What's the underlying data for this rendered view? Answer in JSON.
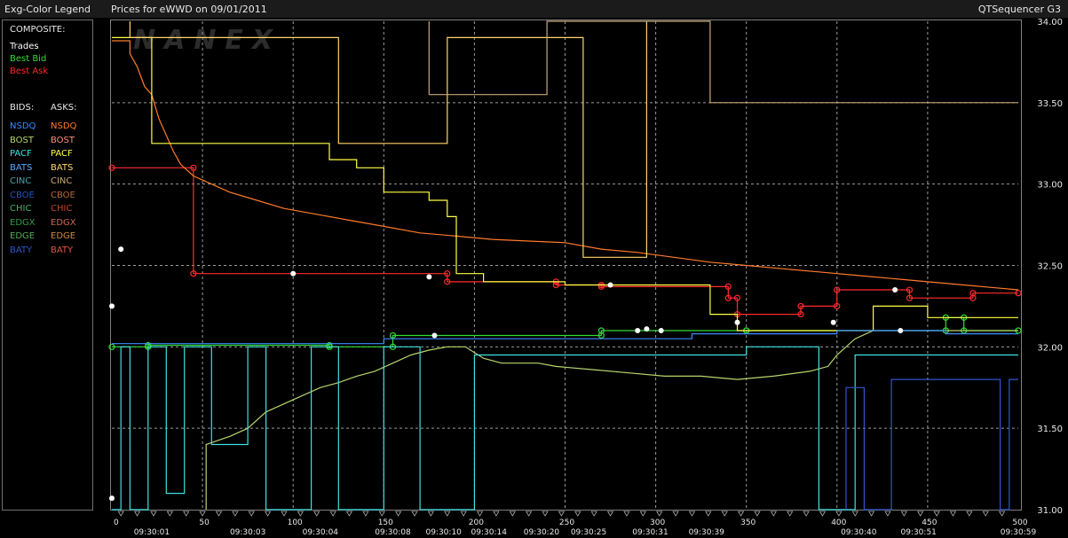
{
  "header": {
    "legend_title": "Exg-Color Legend",
    "chart_title": "Prices for  eWWD  on  09/01/2011",
    "app_name": "QTSequencer G3"
  },
  "legend": {
    "composite_label": "COMPOSITE:",
    "composite": [
      {
        "label": "Trades",
        "color": "#ffffff"
      },
      {
        "label": "Best Bid",
        "color": "#33dd33"
      },
      {
        "label": "Best Ask",
        "color": "#ff2b2b"
      }
    ],
    "bids_label": "BIDS:",
    "asks_label": "ASKS:",
    "rows": [
      {
        "bid": "NSDQ",
        "ask": "NSDQ",
        "bid_color": "#3b8bff",
        "ask_color": "#ff7a2a"
      },
      {
        "bid": "BOST",
        "ask": "BOST",
        "bid_color": "#b5d66b",
        "ask_color": "#ff8f7a"
      },
      {
        "bid": "PACF",
        "ask": "PACF",
        "bid_color": "#3fe0e0",
        "ask_color": "#ffff44"
      },
      {
        "bid": "BATS",
        "ask": "BATS",
        "bid_color": "#5aa8ff",
        "ask_color": "#ffd566"
      },
      {
        "bid": "CINC",
        "ask": "CINC",
        "bid_color": "#4aa8a8",
        "ask_color": "#c8a878"
      },
      {
        "bid": "CBOE",
        "ask": "CBOE",
        "bid_color": "#2255bb",
        "ask_color": "#bb6633"
      },
      {
        "bid": "CHIC",
        "ask": "CHIC",
        "bid_color": "#33bb66",
        "ask_color": "#cc4422"
      },
      {
        "bid": "EDGX",
        "ask": "EDGX",
        "bid_color": "#339944",
        "ask_color": "#cc6655"
      },
      {
        "bid": "EDGE",
        "ask": "EDGE",
        "bid_color": "#55aa55",
        "ask_color": "#cc8844"
      },
      {
        "bid": "BATY",
        "ask": "BATY",
        "bid_color": "#3355cc",
        "ask_color": "#dd5544"
      }
    ]
  },
  "watermark": "NANEX",
  "chart_data": {
    "type": "line",
    "ylim": [
      31.0,
      34.0
    ],
    "xlim": [
      0,
      500
    ],
    "y_ticks": [
      "31.00",
      "31.50",
      "32.00",
      "32.50",
      "33.00",
      "33.50",
      "34.00"
    ],
    "x_ticks": [
      "0",
      "50",
      "100",
      "150",
      "200",
      "250",
      "300",
      "350",
      "400",
      "450",
      "500"
    ],
    "time_labels": [
      {
        "x": 22,
        "label": "09:30:01"
      },
      {
        "x": 75,
        "label": "09:30:03"
      },
      {
        "x": 115,
        "label": "09:30:04"
      },
      {
        "x": 155,
        "label": "09:30:08"
      },
      {
        "x": 183,
        "label": "09:30:10"
      },
      {
        "x": 208,
        "label": "09:30:14"
      },
      {
        "x": 237,
        "label": "09:30:20"
      },
      {
        "x": 263,
        "label": "09:30:25"
      },
      {
        "x": 297,
        "label": "09:30:31"
      },
      {
        "x": 328,
        "label": "09:30:39"
      },
      {
        "x": 412,
        "label": "09:30:40"
      },
      {
        "x": 445,
        "label": "09:30:51"
      },
      {
        "x": 500,
        "label": "09:30:59"
      }
    ],
    "series": [
      {
        "name": "Best Ask",
        "color": "#ff2b2b",
        "markers": true,
        "points": [
          [
            0,
            33.1
          ],
          [
            45,
            33.1
          ],
          [
            45,
            32.45
          ],
          [
            185,
            32.45
          ],
          [
            185,
            32.4
          ],
          [
            245,
            32.4
          ],
          [
            245,
            32.38
          ],
          [
            270,
            32.38
          ],
          [
            270,
            32.37
          ],
          [
            340,
            32.37
          ],
          [
            340,
            32.3
          ],
          [
            345,
            32.3
          ],
          [
            345,
            32.2
          ],
          [
            380,
            32.2
          ],
          [
            380,
            32.25
          ],
          [
            400,
            32.25
          ],
          [
            400,
            32.35
          ],
          [
            440,
            32.35
          ],
          [
            440,
            32.3
          ],
          [
            475,
            32.3
          ],
          [
            475,
            32.33
          ],
          [
            500,
            32.33
          ]
        ]
      },
      {
        "name": "Best Bid",
        "color": "#33dd33",
        "markers": true,
        "points": [
          [
            0,
            32.0
          ],
          [
            20,
            32.0
          ],
          [
            20,
            32.01
          ],
          [
            120,
            32.01
          ],
          [
            120,
            32.0
          ],
          [
            155,
            32.0
          ],
          [
            155,
            32.07
          ],
          [
            270,
            32.07
          ],
          [
            270,
            32.1
          ],
          [
            350,
            32.1
          ],
          [
            350,
            32.1
          ],
          [
            460,
            32.1
          ],
          [
            460,
            32.18
          ],
          [
            470,
            32.18
          ],
          [
            470,
            32.1
          ],
          [
            500,
            32.1
          ]
        ]
      },
      {
        "name": "NSDQ",
        "color": "#ff7a2a",
        "markers": false,
        "points": [
          [
            0,
            33.88
          ],
          [
            10,
            33.88
          ],
          [
            10,
            33.8
          ],
          [
            14,
            33.72
          ],
          [
            18,
            33.6
          ],
          [
            22,
            33.55
          ],
          [
            26,
            33.4
          ],
          [
            30,
            33.3
          ],
          [
            34,
            33.2
          ],
          [
            38,
            33.12
          ],
          [
            45,
            33.05
          ],
          [
            55,
            33.0
          ],
          [
            65,
            32.95
          ],
          [
            80,
            32.9
          ],
          [
            95,
            32.85
          ],
          [
            110,
            32.82
          ],
          [
            130,
            32.78
          ],
          [
            150,
            32.74
          ],
          [
            170,
            32.7
          ],
          [
            190,
            32.68
          ],
          [
            210,
            32.66
          ],
          [
            230,
            32.65
          ],
          [
            250,
            32.64
          ],
          [
            270,
            32.6
          ],
          [
            290,
            32.58
          ],
          [
            310,
            32.55
          ],
          [
            330,
            32.52
          ],
          [
            350,
            32.5
          ],
          [
            370,
            32.48
          ],
          [
            390,
            32.46
          ],
          [
            410,
            32.44
          ],
          [
            430,
            32.42
          ],
          [
            450,
            32.4
          ],
          [
            470,
            32.38
          ],
          [
            490,
            32.36
          ],
          [
            500,
            32.35
          ]
        ]
      },
      {
        "name": "PACF",
        "color": "#ffff44",
        "markers": false,
        "points": [
          [
            0,
            33.9
          ],
          [
            22,
            33.9
          ],
          [
            22,
            33.25
          ],
          [
            120,
            33.25
          ],
          [
            120,
            33.15
          ],
          [
            135,
            33.15
          ],
          [
            135,
            33.1
          ],
          [
            150,
            33.1
          ],
          [
            150,
            32.95
          ],
          [
            175,
            32.95
          ],
          [
            175,
            32.9
          ],
          [
            185,
            32.9
          ],
          [
            185,
            32.8
          ],
          [
            190,
            32.8
          ],
          [
            190,
            32.45
          ],
          [
            205,
            32.45
          ],
          [
            205,
            32.4
          ],
          [
            250,
            32.4
          ],
          [
            250,
            32.38
          ],
          [
            330,
            32.38
          ],
          [
            330,
            32.2
          ],
          [
            345,
            32.2
          ],
          [
            345,
            32.1
          ],
          [
            420,
            32.1
          ],
          [
            420,
            32.25
          ],
          [
            450,
            32.25
          ],
          [
            450,
            32.18
          ],
          [
            500,
            32.18
          ]
        ]
      },
      {
        "name": "BOST",
        "color": "#b5d66b",
        "markers": false,
        "points": [
          [
            52,
            31.0
          ],
          [
            52,
            31.4
          ],
          [
            65,
            31.45
          ],
          [
            75,
            31.5
          ],
          [
            85,
            31.6
          ],
          [
            95,
            31.65
          ],
          [
            105,
            31.7
          ],
          [
            115,
            31.75
          ],
          [
            125,
            31.78
          ],
          [
            135,
            31.82
          ],
          [
            145,
            31.85
          ],
          [
            155,
            31.9
          ],
          [
            165,
            31.95
          ],
          [
            175,
            31.98
          ],
          [
            185,
            32.0
          ],
          [
            195,
            32.0
          ],
          [
            205,
            31.93
          ],
          [
            215,
            31.9
          ],
          [
            235,
            31.9
          ],
          [
            245,
            31.88
          ],
          [
            265,
            31.86
          ],
          [
            285,
            31.84
          ],
          [
            305,
            31.82
          ],
          [
            325,
            31.82
          ],
          [
            345,
            31.8
          ],
          [
            365,
            31.82
          ],
          [
            385,
            31.85
          ],
          [
            395,
            31.88
          ],
          [
            400,
            31.95
          ],
          [
            410,
            32.05
          ],
          [
            420,
            32.1
          ],
          [
            500,
            32.1
          ]
        ]
      },
      {
        "name": "PACF bid",
        "color": "#3fe0e0",
        "markers": false,
        "points": [
          [
            0,
            31.0
          ],
          [
            5,
            31.0
          ],
          [
            5,
            32.0
          ],
          [
            10,
            32.0
          ],
          [
            10,
            31.0
          ],
          [
            20,
            31.0
          ],
          [
            20,
            32.0
          ],
          [
            30,
            32.0
          ],
          [
            30,
            31.1
          ],
          [
            40,
            31.1
          ],
          [
            40,
            32.0
          ],
          [
            55,
            32.0
          ],
          [
            55,
            31.4
          ],
          [
            75,
            31.4
          ],
          [
            75,
            32.0
          ],
          [
            85,
            32.0
          ],
          [
            85,
            31.0
          ],
          [
            110,
            31.0
          ],
          [
            110,
            32.0
          ],
          [
            125,
            32.0
          ],
          [
            125,
            31.0
          ],
          [
            150,
            31.0
          ],
          [
            150,
            32.0
          ],
          [
            170,
            32.0
          ],
          [
            170,
            31.0
          ],
          [
            200,
            31.0
          ],
          [
            200,
            31.95
          ],
          [
            350,
            31.95
          ],
          [
            350,
            32.0
          ],
          [
            390,
            32.0
          ],
          [
            390,
            31.0
          ],
          [
            410,
            31.0
          ],
          [
            410,
            31.95
          ],
          [
            500,
            31.95
          ]
        ]
      },
      {
        "name": "NSDQ bid",
        "color": "#3b8bff",
        "markers": false,
        "points": [
          [
            0,
            32.02
          ],
          [
            150,
            32.02
          ],
          [
            150,
            32.05
          ],
          [
            320,
            32.05
          ],
          [
            320,
            32.08
          ],
          [
            400,
            32.08
          ],
          [
            400,
            32.1
          ],
          [
            460,
            32.1
          ],
          [
            460,
            32.08
          ],
          [
            500,
            32.08
          ]
        ]
      },
      {
        "name": "BATY bid",
        "color": "#3355cc",
        "markers": false,
        "points": [
          [
            405,
            31.0
          ],
          [
            405,
            31.75
          ],
          [
            415,
            31.75
          ],
          [
            415,
            31.0
          ],
          [
            430,
            31.0
          ],
          [
            430,
            31.8
          ],
          [
            490,
            31.8
          ],
          [
            490,
            31.0
          ],
          [
            495,
            31.0
          ],
          [
            495,
            31.8
          ],
          [
            500,
            31.8
          ]
        ]
      },
      {
        "name": "BATS",
        "color": "#ffd566",
        "markers": false,
        "points": [
          [
            10,
            34.0
          ],
          [
            10,
            33.9
          ],
          [
            125,
            33.9
          ],
          [
            125,
            33.25
          ],
          [
            185,
            33.25
          ],
          [
            185,
            33.9
          ],
          [
            260,
            33.9
          ],
          [
            260,
            32.55
          ],
          [
            295,
            32.55
          ],
          [
            295,
            34.0
          ]
        ]
      },
      {
        "name": "CINC",
        "color": "#c8a878",
        "markers": false,
        "points": [
          [
            175,
            34.0
          ],
          [
            175,
            33.55
          ],
          [
            240,
            33.55
          ],
          [
            240,
            34.0
          ],
          [
            330,
            34.0
          ],
          [
            330,
            33.5
          ],
          [
            500,
            33.5
          ]
        ]
      },
      {
        "name": "Trades",
        "color": "#ffffff",
        "markers": true,
        "line": false,
        "points": [
          [
            0,
            32.25
          ],
          [
            0,
            31.07
          ],
          [
            5,
            32.6
          ],
          [
            100,
            32.45
          ],
          [
            175,
            32.43
          ],
          [
            178,
            32.07
          ],
          [
            275,
            32.38
          ],
          [
            290,
            32.1
          ],
          [
            295,
            32.11
          ],
          [
            303,
            32.1
          ],
          [
            345,
            32.15
          ],
          [
            398,
            32.15
          ],
          [
            432,
            32.35
          ],
          [
            435,
            32.1
          ]
        ]
      }
    ]
  }
}
